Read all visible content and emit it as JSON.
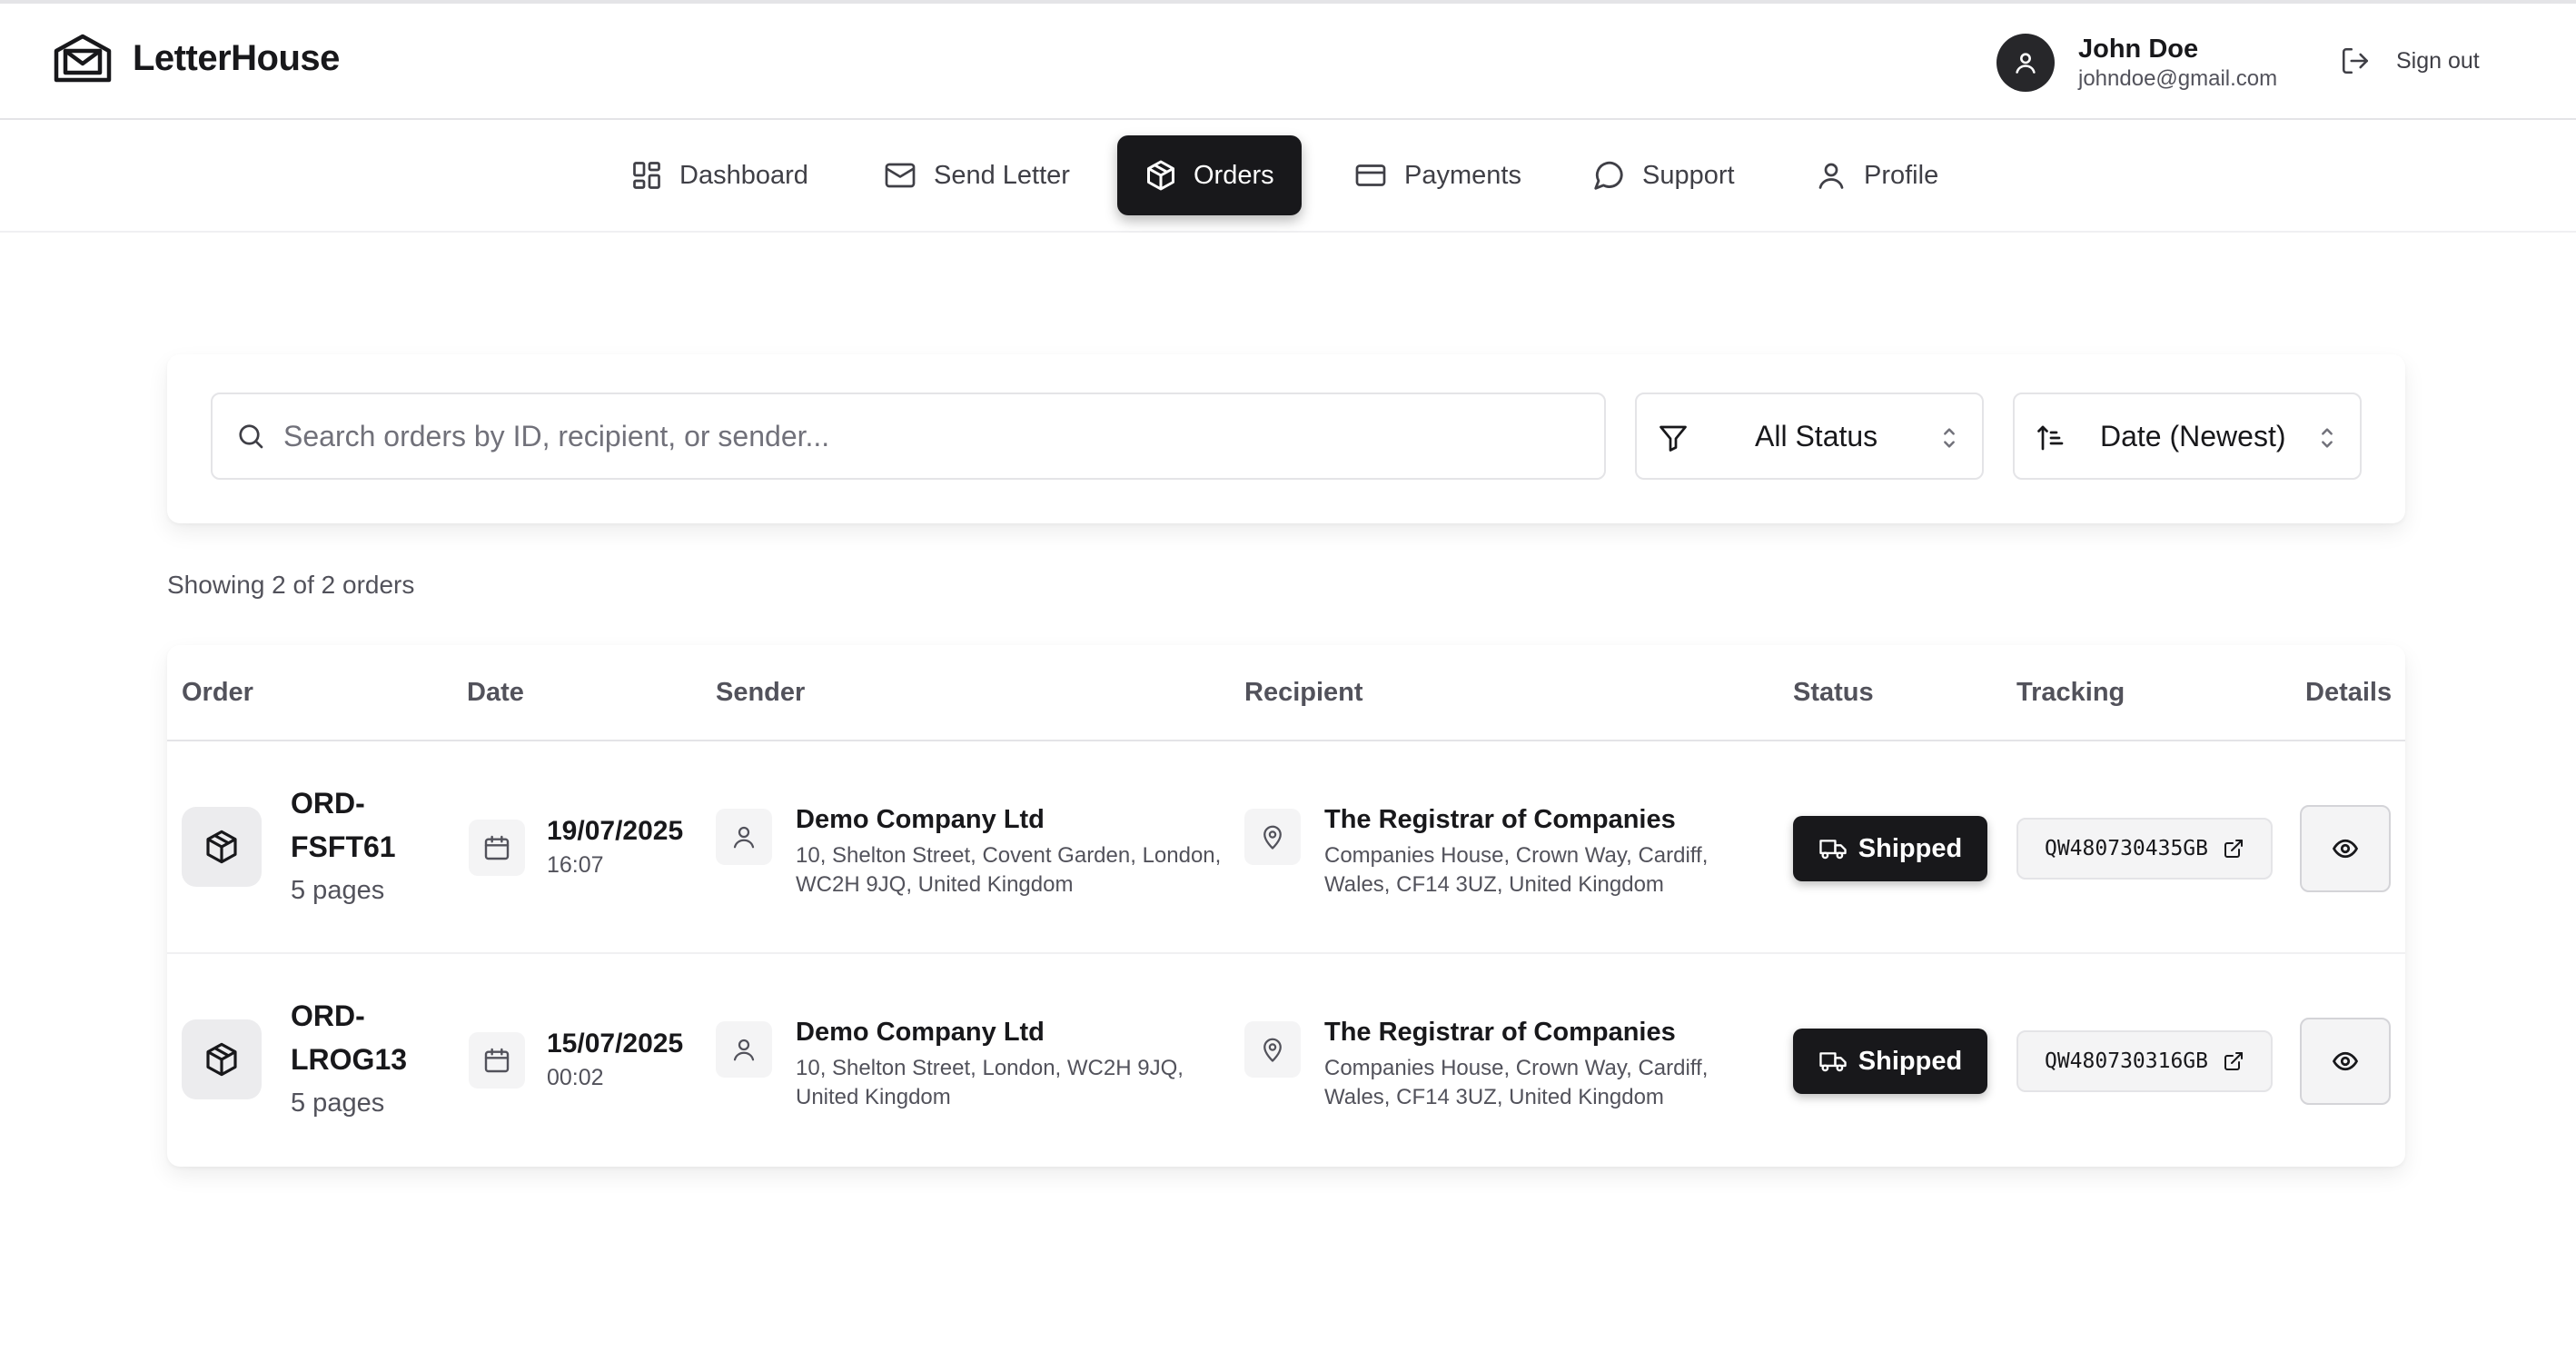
{
  "app": {
    "name": "LetterHouse"
  },
  "user": {
    "name": "John Doe",
    "email": "johndoe@gmail.com",
    "sign_out_label": "Sign out"
  },
  "nav": {
    "items": [
      {
        "label": "Dashboard",
        "icon": "dashboard-grid-icon",
        "active": false
      },
      {
        "label": "Send Letter",
        "icon": "mail-icon",
        "active": false
      },
      {
        "label": "Orders",
        "icon": "package-icon",
        "active": true
      },
      {
        "label": "Payments",
        "icon": "credit-card-icon",
        "active": false
      },
      {
        "label": "Support",
        "icon": "chat-bubble-icon",
        "active": false
      },
      {
        "label": "Profile",
        "icon": "user-icon",
        "active": false
      }
    ]
  },
  "filters": {
    "search_placeholder": "Search orders by ID, recipient, or sender...",
    "search_value": "",
    "status_value": "All Status",
    "sort_value": "Date (Newest)"
  },
  "summary": {
    "showing": "Showing 2 of 2 orders"
  },
  "table": {
    "columns": [
      "Order",
      "Date",
      "Sender",
      "Recipient",
      "Status",
      "Tracking",
      "Details"
    ],
    "rows": [
      {
        "order_id_line1": "ORD-",
        "order_id_line2": "FSFT61",
        "pages": "5 pages",
        "date": "19/07/2025",
        "time": "16:07",
        "sender_name": "Demo Company Ltd",
        "sender_address": "10, Shelton Street, Covent Garden, London, WC2H 9JQ, United Kingdom",
        "recipient_name": "The Registrar of Companies",
        "recipient_address": "Companies House, Crown Way, Cardiff, Wales, CF14 3UZ, United Kingdom",
        "status": "Shipped",
        "tracking": "QW480730435GB"
      },
      {
        "order_id_line1": "ORD-",
        "order_id_line2": "LROG13",
        "pages": "5 pages",
        "date": "15/07/2025",
        "time": "00:02",
        "sender_name": "Demo Company Ltd",
        "sender_address": "10, Shelton Street, London, WC2H 9JQ, United Kingdom",
        "recipient_name": "The Registrar of Companies",
        "recipient_address": "Companies House, Crown Way, Cardiff, Wales, CF14 3UZ, United Kingdom",
        "status": "Shipped",
        "tracking": "QW480730316GB"
      }
    ]
  },
  "colors": {
    "primary": "#18181b",
    "muted_text": "#52525b",
    "border": "#e4e4e7",
    "surface": "#f4f4f5"
  }
}
